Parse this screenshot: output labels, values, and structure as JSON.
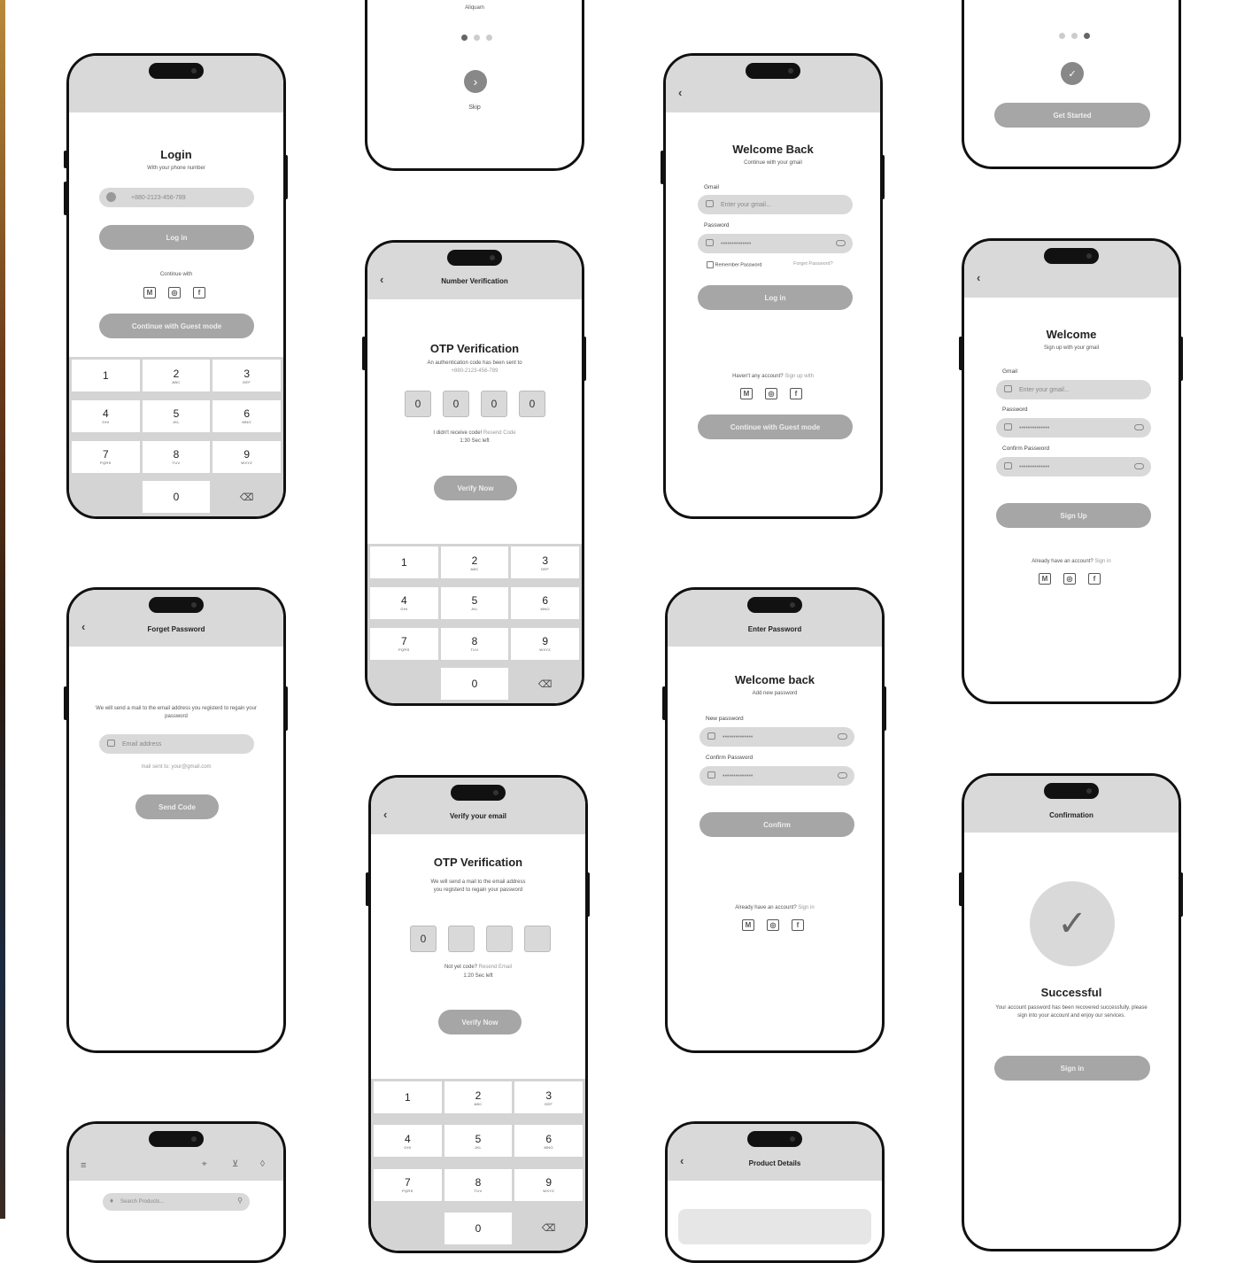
{
  "login": {
    "title": "Login",
    "subtitle": "With your phone number",
    "phone_placeholder": "+880-2123-456-789",
    "login_button": "Log in",
    "continue_with": "Continue with",
    "guest_button": "Continue with Guest mode"
  },
  "keypad": [
    {
      "n": "1",
      "l": ""
    },
    {
      "n": "2",
      "l": "ABC"
    },
    {
      "n": "3",
      "l": "DEF"
    },
    {
      "n": "4",
      "l": "GHI"
    },
    {
      "n": "5",
      "l": "JKL"
    },
    {
      "n": "6",
      "l": "MNO"
    },
    {
      "n": "7",
      "l": "PQRS"
    },
    {
      "n": "8",
      "l": "TUV"
    },
    {
      "n": "9",
      "l": "WXYZ"
    },
    {
      "n": "",
      "l": ""
    },
    {
      "n": "0",
      "l": ""
    },
    {
      "n": "⌫",
      "l": ""
    }
  ],
  "onboarding": {
    "caption": "Aliquam",
    "skip": "Skip",
    "get_started": "Get Started"
  },
  "number_verification": {
    "header": "Number Verification",
    "title": "OTP Verification",
    "subtitle": "An authentication code has been sent to",
    "phone": "+880-2123-456-789",
    "digits": [
      "0",
      "0",
      "0",
      "0"
    ],
    "resend_text": "I didn't receive code!",
    "resend_link": "Resend Code",
    "timer": "1:30 Sec left",
    "verify_button": "Verify Now"
  },
  "welcome_back": {
    "title": "Welcome Back",
    "subtitle": "Continue with your gmail",
    "gmail_label": "Gmail",
    "gmail_placeholder": "Enter your gmail...",
    "password_label": "Password",
    "password_value": "••••••••••••••",
    "remember": "Remember Password",
    "forgot": "Forget Password?",
    "login_button": "Log in",
    "no_account": "Haven't any account?",
    "signup_link": "Sign up with",
    "guest_button": "Continue with Guest mode"
  },
  "welcome_signup": {
    "title": "Welcome",
    "subtitle": "Sign up with your gmail",
    "gmail_label": "Gmail",
    "gmail_placeholder": "Enter your gmail...",
    "password_label": "Password",
    "password_value": "••••••••••••••",
    "confirm_label": "Confirm Password",
    "confirm_value": "••••••••••••••",
    "signup_button": "Sign Up",
    "have_account": "Already have an account?",
    "signin_link": "Sign in"
  },
  "forget_password": {
    "header": "Forget Password",
    "description": "We will send a mail to the email address you registerd to regain your password",
    "email_placeholder": "Email address",
    "hint": "mail sent to: your@gmail.com",
    "send_button": "Send Code"
  },
  "verify_email": {
    "header": "Verify your email",
    "title": "OTP Verification",
    "description": "We will send a mail to the email address you registerd to regain your password",
    "digits": [
      "0",
      "",
      "",
      ""
    ],
    "resend_text": "Not yet code?",
    "resend_link": "Resend Email",
    "timer": "1:20 Sec left",
    "verify_button": "Verify Now"
  },
  "enter_password": {
    "header": "Enter Password",
    "title": "Welcome back",
    "subtitle": "Add new password",
    "new_label": "New password",
    "new_value": "••••••••••••••",
    "confirm_label": "Confirm Password",
    "confirm_value": "••••••••••••••",
    "confirm_button": "Confirm",
    "have_account": "Already have an account?",
    "signin_link": "Sign in"
  },
  "confirmation": {
    "header": "Confirmation",
    "title": "Successful",
    "description": "Your account password has been recovered successfully. please sign into your account and enjoy our services.",
    "signin_button": "Sign in"
  },
  "home": {
    "search_placeholder": "Search Products..."
  },
  "product_details": {
    "header": "Product Details"
  },
  "social_icons": [
    "gmail-icon",
    "whatsapp-icon",
    "facebook-icon"
  ],
  "colors": {
    "frame": "#111111",
    "header": "#d9d9d9",
    "button": "#a6a6a6",
    "field": "#d9d9d9"
  }
}
